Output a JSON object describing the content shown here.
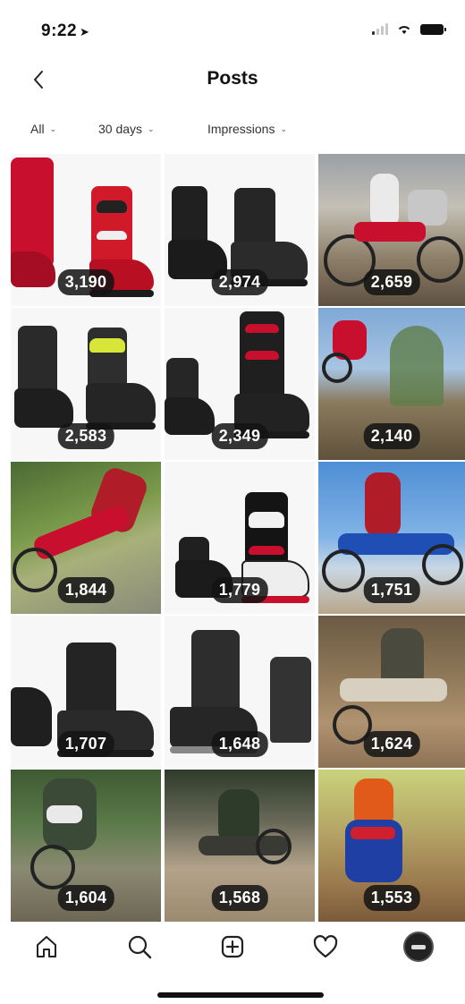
{
  "status_bar": {
    "time": "9:22"
  },
  "header": {
    "title": "Posts"
  },
  "filters": [
    {
      "label": "All"
    },
    {
      "label": "30 days"
    },
    {
      "label": "Impressions"
    }
  ],
  "posts": [
    {
      "count": "3,190"
    },
    {
      "count": "2,974"
    },
    {
      "count": "2,659"
    },
    {
      "count": "2,583"
    },
    {
      "count": "2,349"
    },
    {
      "count": "2,140"
    },
    {
      "count": "1,844"
    },
    {
      "count": "1,779"
    },
    {
      "count": "1,751"
    },
    {
      "count": "1,707"
    },
    {
      "count": "1,648"
    },
    {
      "count": "1,624"
    },
    {
      "count": "1,604"
    },
    {
      "count": "1,568"
    },
    {
      "count": "1,553"
    }
  ],
  "tabbar": {
    "items": [
      {
        "icon": "home-icon"
      },
      {
        "icon": "search-icon"
      },
      {
        "icon": "new-post-icon"
      },
      {
        "icon": "activity-heart-icon"
      },
      {
        "icon": "profile-avatar"
      }
    ]
  },
  "colors": {
    "accent": "#111111",
    "badge_bg": "#141414"
  }
}
